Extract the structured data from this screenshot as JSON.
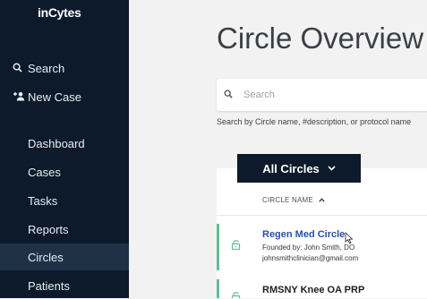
{
  "brand": {
    "logo": "inCytes"
  },
  "sidebar": {
    "search": "Search",
    "new_case": "New Case",
    "items": [
      {
        "label": "Dashboard"
      },
      {
        "label": "Cases"
      },
      {
        "label": "Tasks"
      },
      {
        "label": "Reports"
      },
      {
        "label": "Circles",
        "active": true
      },
      {
        "label": "Patients"
      }
    ]
  },
  "main": {
    "title": "Circle Overview",
    "search_placeholder": "Search",
    "search_help": "Search by Circle name, #description, or protocol name",
    "filter_label": "All Circles",
    "column_header": "CIRCLE NAME",
    "rows": [
      {
        "title": "Regen Med Circle",
        "founded_by": "Founded by: John Smith, DO",
        "email": "johnsmithclinician@gmail.com"
      },
      {
        "title": "RMSNY Knee OA PRP"
      }
    ]
  },
  "colors": {
    "sidebar_bg": "#0c1a2b",
    "active_bg": "#1f3147",
    "accent_green": "#5fbf95",
    "link_blue": "#2a4fa8"
  }
}
